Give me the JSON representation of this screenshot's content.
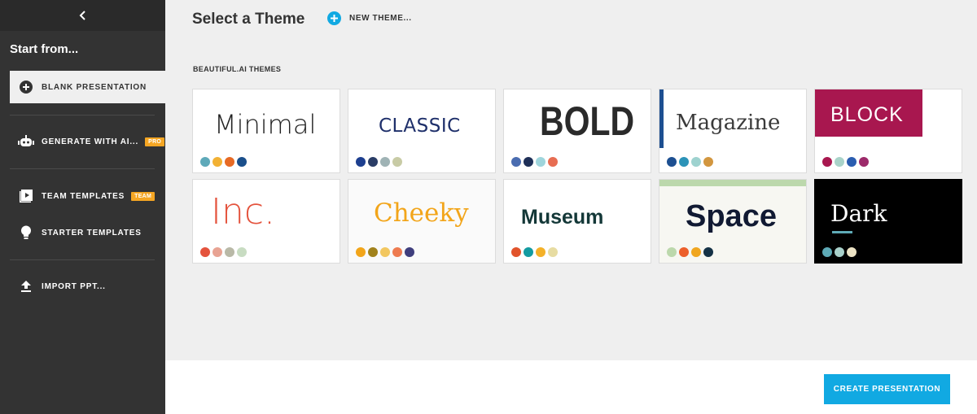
{
  "sidebar": {
    "start_from": "Start from...",
    "items": [
      {
        "label": "BLANK PRESENTATION",
        "icon": "plus-circle-icon"
      },
      {
        "label": "GENERATE WITH AI...",
        "icon": "robot-icon",
        "badge": "PRO"
      },
      {
        "label": "TEAM TEMPLATES",
        "icon": "play-templates-icon",
        "badge": "TEAM"
      },
      {
        "label": "STARTER TEMPLATES",
        "icon": "lightbulb-icon"
      },
      {
        "label": "IMPORT PPT...",
        "icon": "upload-icon"
      }
    ]
  },
  "header": {
    "title": "Select a Theme",
    "new_theme_label": "NEW THEME..."
  },
  "section_label": "BEAUTIFUL.AI THEMES",
  "themes": [
    {
      "name": "Minimal",
      "colors": [
        "#5ea9b9",
        "#f2b134",
        "#e76a24",
        "#1a4f8b"
      ]
    },
    {
      "name": "CLASSIC",
      "colors": [
        "#1d3f8f",
        "#2a3d66",
        "#9fb3b5",
        "#c8cba5"
      ]
    },
    {
      "name": "BOLD",
      "colors": [
        "#4a6cb0",
        "#1e2f57",
        "#9fd5dc",
        "#e76d52"
      ]
    },
    {
      "name": "Magazine",
      "colors": [
        "#1d4f91",
        "#2c93b8",
        "#9ed2cf",
        "#d2963f"
      ]
    },
    {
      "name": "BLOCK",
      "colors": [
        "#a8174f",
        "#a9d3c9",
        "#2a5db0",
        "#9c2a6a"
      ]
    },
    {
      "name": "Inc.",
      "colors": [
        "#e4533d",
        "#e8a393",
        "#b9b9a7",
        "#c8dcc2"
      ]
    },
    {
      "name": "Cheeky",
      "colors": [
        "#f2a51a",
        "#a1821c",
        "#f2c760",
        "#ee7b50",
        "#3f3e7d"
      ]
    },
    {
      "name": "Museum",
      "colors": [
        "#e1532b",
        "#139ba1",
        "#f4b129",
        "#e7dca2"
      ]
    },
    {
      "name": "Space",
      "colors": [
        "#bcd8ac",
        "#ec5f2b",
        "#f0a61f",
        "#153246"
      ]
    },
    {
      "name": "Dark",
      "colors": [
        "#5eaab7",
        "#a9d1cb",
        "#ece3c5"
      ]
    }
  ],
  "footer": {
    "create_label": "CREATE PRESENTATION"
  },
  "colors": {
    "accent": "#11a9e2",
    "sidebar_bg": "#333333",
    "badge": "#f5a623"
  }
}
